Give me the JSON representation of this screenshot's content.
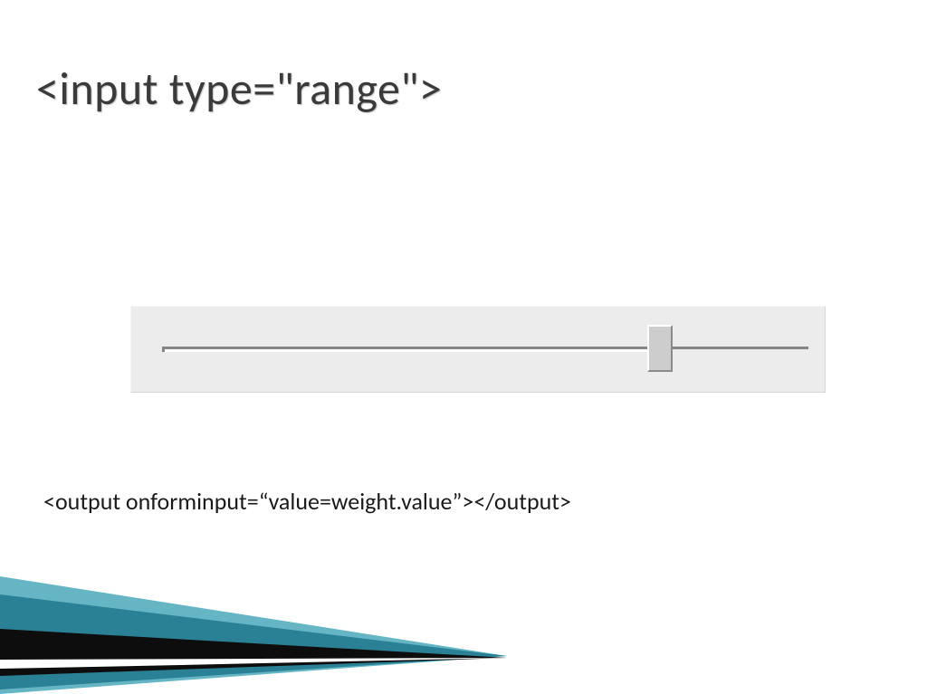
{
  "title": "<input type=\"range\">",
  "code_line": "<output onforminput=“value=weight.value”></output>",
  "slider": {
    "value_percent": 77
  }
}
